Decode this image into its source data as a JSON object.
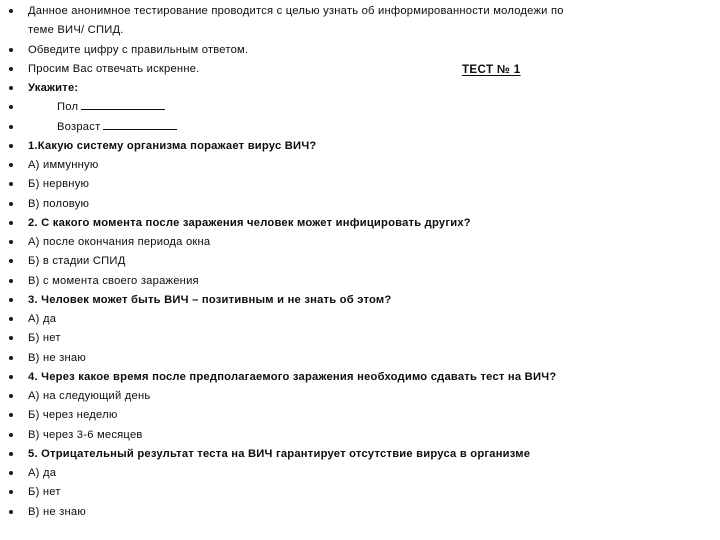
{
  "document": {
    "type": "slide",
    "background_color": "#ffffff",
    "text_color": "#0d0d0d",
    "bullet_glyph": "•",
    "heading": {
      "label": "ТЕСТ № 1",
      "bold": true,
      "underline": true
    },
    "lines": [
      {
        "id": "intro-1",
        "bullet": true,
        "bold": false,
        "indent": 0,
        "text": "Данное анонимное тестирование проводится с целью узнать об информированности молодежи по"
      },
      {
        "id": "intro-1-cont",
        "bullet": false,
        "bold": false,
        "indent": 0,
        "text": "теме ВИЧ/ СПИД."
      },
      {
        "id": "intro-2",
        "bullet": true,
        "bold": false,
        "indent": 0,
        "text": "Обведите цифру с правильным ответом."
      },
      {
        "id": "intro-3",
        "bullet": true,
        "bold": false,
        "indent": 0,
        "text": "Просим Вас отвечать искренне.",
        "heading_on_line": true
      },
      {
        "id": "ukazhite",
        "bullet": true,
        "bold": true,
        "indent": 0,
        "text": "Укажите:"
      },
      {
        "id": "field-pol",
        "bullet": true,
        "bold": false,
        "indent": 1,
        "text": "Пол",
        "blank": "pol"
      },
      {
        "id": "field-vozrast",
        "bullet": true,
        "bold": false,
        "indent": 1,
        "text": "Возраст",
        "blank": "vozr"
      },
      {
        "id": "q1",
        "bullet": true,
        "bold": true,
        "indent": 0,
        "text": "1.Какую систему организма поражает вирус ВИЧ?"
      },
      {
        "id": "q1-a",
        "bullet": true,
        "bold": false,
        "indent": 0,
        "text": "А) иммунную"
      },
      {
        "id": "q1-b",
        "bullet": true,
        "bold": false,
        "indent": 0,
        "text": "Б) нервную"
      },
      {
        "id": "q1-v",
        "bullet": true,
        "bold": false,
        "indent": 0,
        "text": "В) половую"
      },
      {
        "id": "q2",
        "bullet": true,
        "bold": true,
        "indent": 0,
        "text": "2. С какого момента после заражения человек может инфицировать других?"
      },
      {
        "id": "q2-a",
        "bullet": true,
        "bold": false,
        "indent": 0,
        "text": "А) после окончания периода окна"
      },
      {
        "id": "q2-b",
        "bullet": true,
        "bold": false,
        "indent": 0,
        "text": "Б) в стадии СПИД"
      },
      {
        "id": "q2-v",
        "bullet": true,
        "bold": false,
        "indent": 0,
        "text": "В) с момента своего заражения"
      },
      {
        "id": "q3",
        "bullet": true,
        "bold": true,
        "indent": 0,
        "text": "3. Человек может быть ВИЧ – позитивным и не знать об этом?"
      },
      {
        "id": "q3-a",
        "bullet": true,
        "bold": false,
        "indent": 0,
        "text": "А) да"
      },
      {
        "id": "q3-b",
        "bullet": true,
        "bold": false,
        "indent": 0,
        "text": "Б) нет"
      },
      {
        "id": "q3-v",
        "bullet": true,
        "bold": false,
        "indent": 0,
        "text": "В) не знаю"
      },
      {
        "id": "q4",
        "bullet": true,
        "bold": true,
        "indent": 0,
        "text": "4. Через какое время после предполагаемого заражения необходимо сдавать тест на ВИЧ?"
      },
      {
        "id": "q4-a",
        "bullet": true,
        "bold": false,
        "indent": 0,
        "text": "А) на следующий день"
      },
      {
        "id": "q4-b",
        "bullet": true,
        "bold": false,
        "indent": 0,
        "text": "Б) через неделю"
      },
      {
        "id": "q4-v",
        "bullet": true,
        "bold": false,
        "indent": 0,
        "text": "В) через 3-6 месяцев"
      },
      {
        "id": "q5",
        "bullet": true,
        "bold": true,
        "indent": 0,
        "text": "5. Отрицательный результат теста на ВИЧ гарантирует отсутствие вируса в организме"
      },
      {
        "id": "q5-a",
        "bullet": true,
        "bold": false,
        "indent": 0,
        "text": "А) да"
      },
      {
        "id": "q5-b",
        "bullet": true,
        "bold": false,
        "indent": 0,
        "text": "Б) нет"
      },
      {
        "id": "q5-v",
        "bullet": true,
        "bold": false,
        "indent": 0,
        "text": "В) не знаю"
      }
    ]
  }
}
